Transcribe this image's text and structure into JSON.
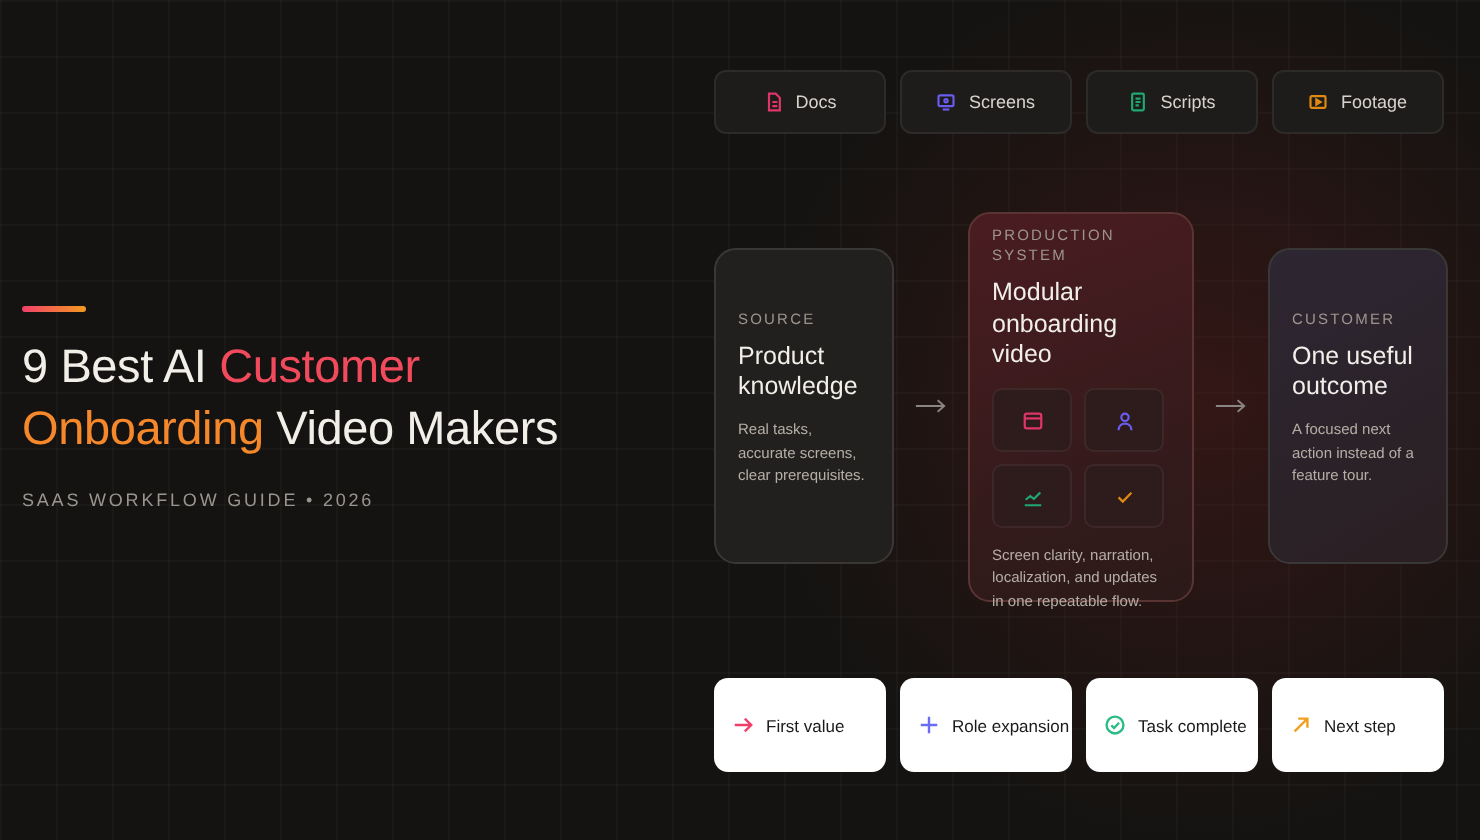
{
  "accent_bar": true,
  "title": [
    [
      {
        "text": "9 Best AI ",
        "kind": "plain"
      },
      {
        "text": "Customer",
        "kind": "accent"
      }
    ],
    [
      {
        "text": "Onboarding",
        "kind": "accent2"
      },
      {
        "text": " Video Makers",
        "kind": "plain"
      }
    ]
  ],
  "subtitle": "SAAS WORKFLOW GUIDE • 2026",
  "inputs": [
    {
      "label": "Docs",
      "kind": "doc",
      "color": "#e0356a"
    },
    {
      "label": "Screens",
      "kind": "screen",
      "color": "#6a5cf0"
    },
    {
      "label": "Scripts",
      "kind": "script",
      "color": "#1fa870"
    },
    {
      "label": "Footage",
      "kind": "video",
      "color": "#e08a12"
    }
  ],
  "source": {
    "label": "SOURCE",
    "title": "Product knowledge",
    "text": "Real tasks, accurate screens, clear prerequisites."
  },
  "system": {
    "label": "PRODUCTION SYSTEM",
    "title": "Modular onboarding video",
    "text": "Screen clarity, narration, localization, and updates in one repeatable flow.",
    "tiles": [
      {
        "kind": "window",
        "color": "#e0356a"
      },
      {
        "kind": "person",
        "color": "#6a5cf0"
      },
      {
        "kind": "chart",
        "color": "#1fa870"
      },
      {
        "kind": "check",
        "color": "#e08a12"
      }
    ]
  },
  "customer": {
    "label": "CUSTOMER",
    "title": "One useful outcome",
    "text": "A focused next action instead of a feature tour."
  },
  "outcomes": [
    {
      "label": "First value",
      "kind": "arrow",
      "color": "#f0406a"
    },
    {
      "label": "Role expansion",
      "kind": "plus",
      "color": "#6a6cf5"
    },
    {
      "label": "Task complete",
      "kind": "check-circle",
      "color": "#2dbb85"
    },
    {
      "label": "Next step",
      "kind": "arrow-up",
      "color": "#f0a020"
    }
  ]
}
